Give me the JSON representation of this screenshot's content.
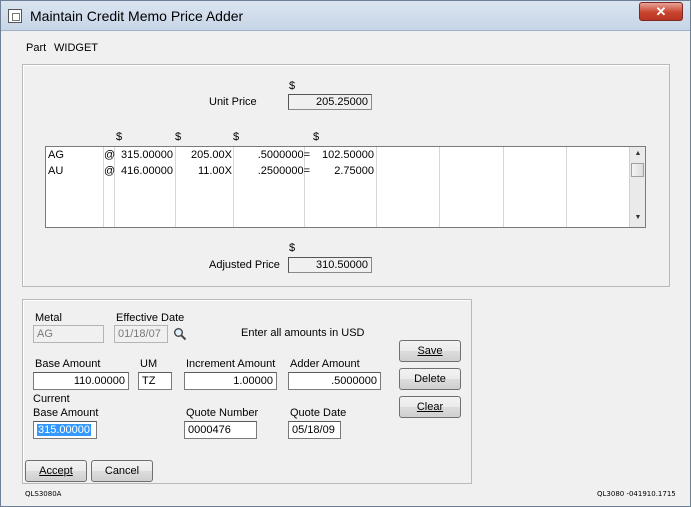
{
  "window": {
    "title": "Maintain Credit Memo Price Adder",
    "close_glyph": "✕"
  },
  "part": {
    "label": "Part",
    "value": "WIDGET"
  },
  "unit_price": {
    "currency": "$",
    "label": "Unit Price",
    "value": "205.25000"
  },
  "list": {
    "headers": [
      "$",
      "$",
      "$",
      "$"
    ],
    "rows": [
      {
        "metal": "AG",
        "at": "@",
        "base": "315.00000",
        "incr": "205.00X",
        "adder": ".5000000=",
        "result": "102.50000"
      },
      {
        "metal": "AU",
        "at": "@",
        "base": "416.00000",
        "incr": "11.00X",
        "adder": ".2500000=",
        "result": "2.75000"
      }
    ],
    "scroll_up_glyph": "▲",
    "scroll_down_glyph": "▼"
  },
  "adjusted_price": {
    "currency": "$",
    "label": "Adjusted Price",
    "value": "310.50000"
  },
  "detail": {
    "metal_label": "Metal",
    "metal_value": "AG",
    "effective_date_label": "Effective Date",
    "effective_date_value": "01/18/07",
    "search_icon": "magnifier",
    "usd_note": "Enter all amounts in USD",
    "base_amount_label": "Base Amount",
    "base_amount_value": "110.00000",
    "um_label": "UM",
    "um_value": "TZ",
    "increment_amount_label": "Increment Amount",
    "increment_amount_value": "1.00000",
    "adder_amount_label": "Adder Amount",
    "adder_amount_value": ".5000000",
    "current_label": "Current",
    "current_base_label": "Base Amount",
    "current_base_value": "315.00000",
    "quote_number_label": "Quote Number",
    "quote_number_value": "0000476",
    "quote_date_label": "Quote Date",
    "quote_date_value": "05/18/09"
  },
  "buttons": {
    "save": "Save",
    "delete": "Delete",
    "clear": "Clear",
    "accept": "Accept",
    "cancel": "Cancel"
  },
  "footer": {
    "left": "QLS3080A",
    "right": "QL3080 -041910.1715"
  }
}
